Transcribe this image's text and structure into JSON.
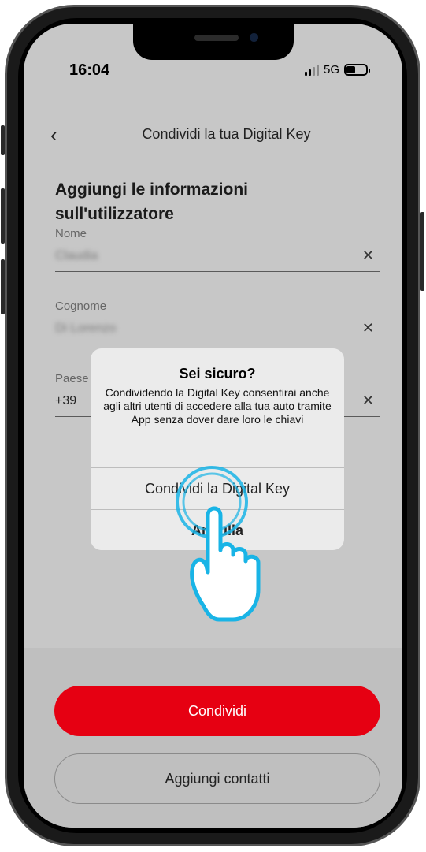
{
  "status_bar": {
    "time": "16:04",
    "network": "5G",
    "battery_level": 0.45
  },
  "header": {
    "back_icon": "chevron-left-icon",
    "title": "Condividi la tua Digital Key"
  },
  "section": {
    "title": "Aggiungi le informazioni sull'utilizzatore"
  },
  "fields": {
    "nome": {
      "label": "Nome",
      "value": "Claudia"
    },
    "cognome": {
      "label": "Cognome",
      "value": "Di Lorenzo"
    },
    "paese": {
      "label": "Paese",
      "value": "+39"
    }
  },
  "dialog": {
    "title": "Sei sicuro?",
    "message": "Condividendo la Digital Key consentirai anche agli altri utenti di accedere alla tua auto tramite App senza dover dare loro le chiavi",
    "confirm_label": "Condividi la Digital Key",
    "cancel_label": "Annulla"
  },
  "actions": {
    "share_label": "Condividi",
    "add_contacts_label": "Aggiungi contatti"
  },
  "colors": {
    "accent": "#e60012",
    "pointer": "#19b4e6"
  }
}
